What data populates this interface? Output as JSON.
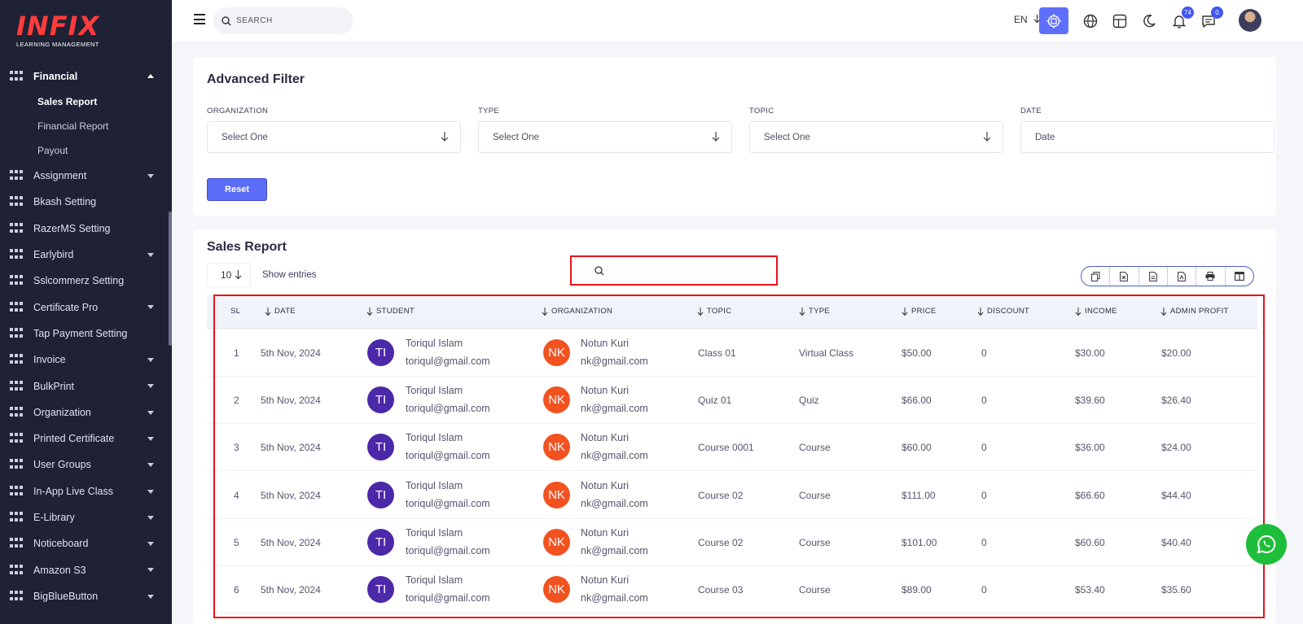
{
  "brand": {
    "logo_text": "INFIX",
    "logo_sub": "LEARNING MANAGEMENT"
  },
  "header": {
    "search_placeholder": "SEARCH",
    "language": "EN",
    "notifications_count": "74",
    "messages_count": "0"
  },
  "sidebar": {
    "active_section": "Financial",
    "sub_items": [
      "Sales Report",
      "Financial Report",
      "Payout"
    ],
    "items": [
      {
        "label": "Assignment",
        "caret": true
      },
      {
        "label": "Bkash Setting",
        "caret": false
      },
      {
        "label": "RazerMS Setting",
        "caret": false
      },
      {
        "label": "Earlybird",
        "caret": true
      },
      {
        "label": "Sslcommerz Setting",
        "caret": false
      },
      {
        "label": "Certificate Pro",
        "caret": true
      },
      {
        "label": "Tap Payment Setting",
        "caret": false
      },
      {
        "label": "Invoice",
        "caret": true
      },
      {
        "label": "BulkPrint",
        "caret": true
      },
      {
        "label": "Organization",
        "caret": true
      },
      {
        "label": "Printed Certificate",
        "caret": true
      },
      {
        "label": "User Groups",
        "caret": true
      },
      {
        "label": "In-App Live Class",
        "caret": true
      },
      {
        "label": "E-Library",
        "caret": true
      },
      {
        "label": "Noticeboard",
        "caret": true
      },
      {
        "label": "Amazon S3",
        "caret": true
      },
      {
        "label": "BigBlueButton",
        "caret": true
      }
    ]
  },
  "filter": {
    "title": "Advanced Filter",
    "fields": [
      {
        "label": "ORGANIZATION",
        "value": "Select One"
      },
      {
        "label": "TYPE",
        "value": "Select One"
      },
      {
        "label": "TOPIC",
        "value": "Select One"
      },
      {
        "label": "DATE",
        "value": "Date"
      }
    ],
    "reset_label": "Reset"
  },
  "sales": {
    "title": "Sales Report",
    "entries": "10",
    "show_entries_label": "Show entries",
    "columns": [
      "SL",
      "DATE",
      "STUDENT",
      "ORGANIZATION",
      "TOPIC",
      "TYPE",
      "PRICE",
      "DISCOUNT",
      "INCOME",
      "ADMIN PROFIT"
    ],
    "rows": [
      {
        "sl": "1",
        "date": "5th Nov, 2024",
        "student_initials": "TI",
        "student_name": "Toriqul Islam",
        "student_email": "toriqul@gmail.com",
        "org_initials": "NK",
        "org_name": "Notun Kuri",
        "org_email": "nk@gmail.com",
        "topic": "Class 01",
        "type": "Virtual Class",
        "price": "$50.00",
        "discount": "0",
        "income": "$30.00",
        "admin_profit": "$20.00"
      },
      {
        "sl": "2",
        "date": "5th Nov, 2024",
        "student_initials": "TI",
        "student_name": "Toriqul Islam",
        "student_email": "toriqul@gmail.com",
        "org_initials": "NK",
        "org_name": "Notun Kuri",
        "org_email": "nk@gmail.com",
        "topic": "Quiz 01",
        "type": "Quiz",
        "price": "$66.00",
        "discount": "0",
        "income": "$39.60",
        "admin_profit": "$26.40"
      },
      {
        "sl": "3",
        "date": "5th Nov, 2024",
        "student_initials": "TI",
        "student_name": "Toriqul Islam",
        "student_email": "toriqul@gmail.com",
        "org_initials": "NK",
        "org_name": "Notun Kuri",
        "org_email": "nk@gmail.com",
        "topic": "Course 0001",
        "type": "Course",
        "price": "$60.00",
        "discount": "0",
        "income": "$36.00",
        "admin_profit": "$24.00"
      },
      {
        "sl": "4",
        "date": "5th Nov, 2024",
        "student_initials": "TI",
        "student_name": "Toriqul Islam",
        "student_email": "toriqul@gmail.com",
        "org_initials": "NK",
        "org_name": "Notun Kuri",
        "org_email": "nk@gmail.com",
        "topic": "Course 02",
        "type": "Course",
        "price": "$111.00",
        "discount": "0",
        "income": "$66.60",
        "admin_profit": "$44.40"
      },
      {
        "sl": "5",
        "date": "5th Nov, 2024",
        "student_initials": "TI",
        "student_name": "Toriqul Islam",
        "student_email": "toriqul@gmail.com",
        "org_initials": "NK",
        "org_name": "Notun Kuri",
        "org_email": "nk@gmail.com",
        "topic": "Course 02",
        "type": "Course",
        "price": "$101.00",
        "discount": "0",
        "income": "$60.60",
        "admin_profit": "$40.40"
      },
      {
        "sl": "6",
        "date": "5th Nov, 2024",
        "student_initials": "TI",
        "student_name": "Toriqul Islam",
        "student_email": "toriqul@gmail.com",
        "org_initials": "NK",
        "org_name": "Notun Kuri",
        "org_email": "nk@gmail.com",
        "topic": "Course 03",
        "type": "Course",
        "price": "$89.00",
        "discount": "0",
        "income": "$53.40",
        "admin_profit": "$35.60"
      }
    ]
  },
  "colors": {
    "sidebar_bg": "#1f2235",
    "accent": "#5e6ffc",
    "highlight": "#e8141b",
    "whatsapp": "#1ebd3a"
  }
}
